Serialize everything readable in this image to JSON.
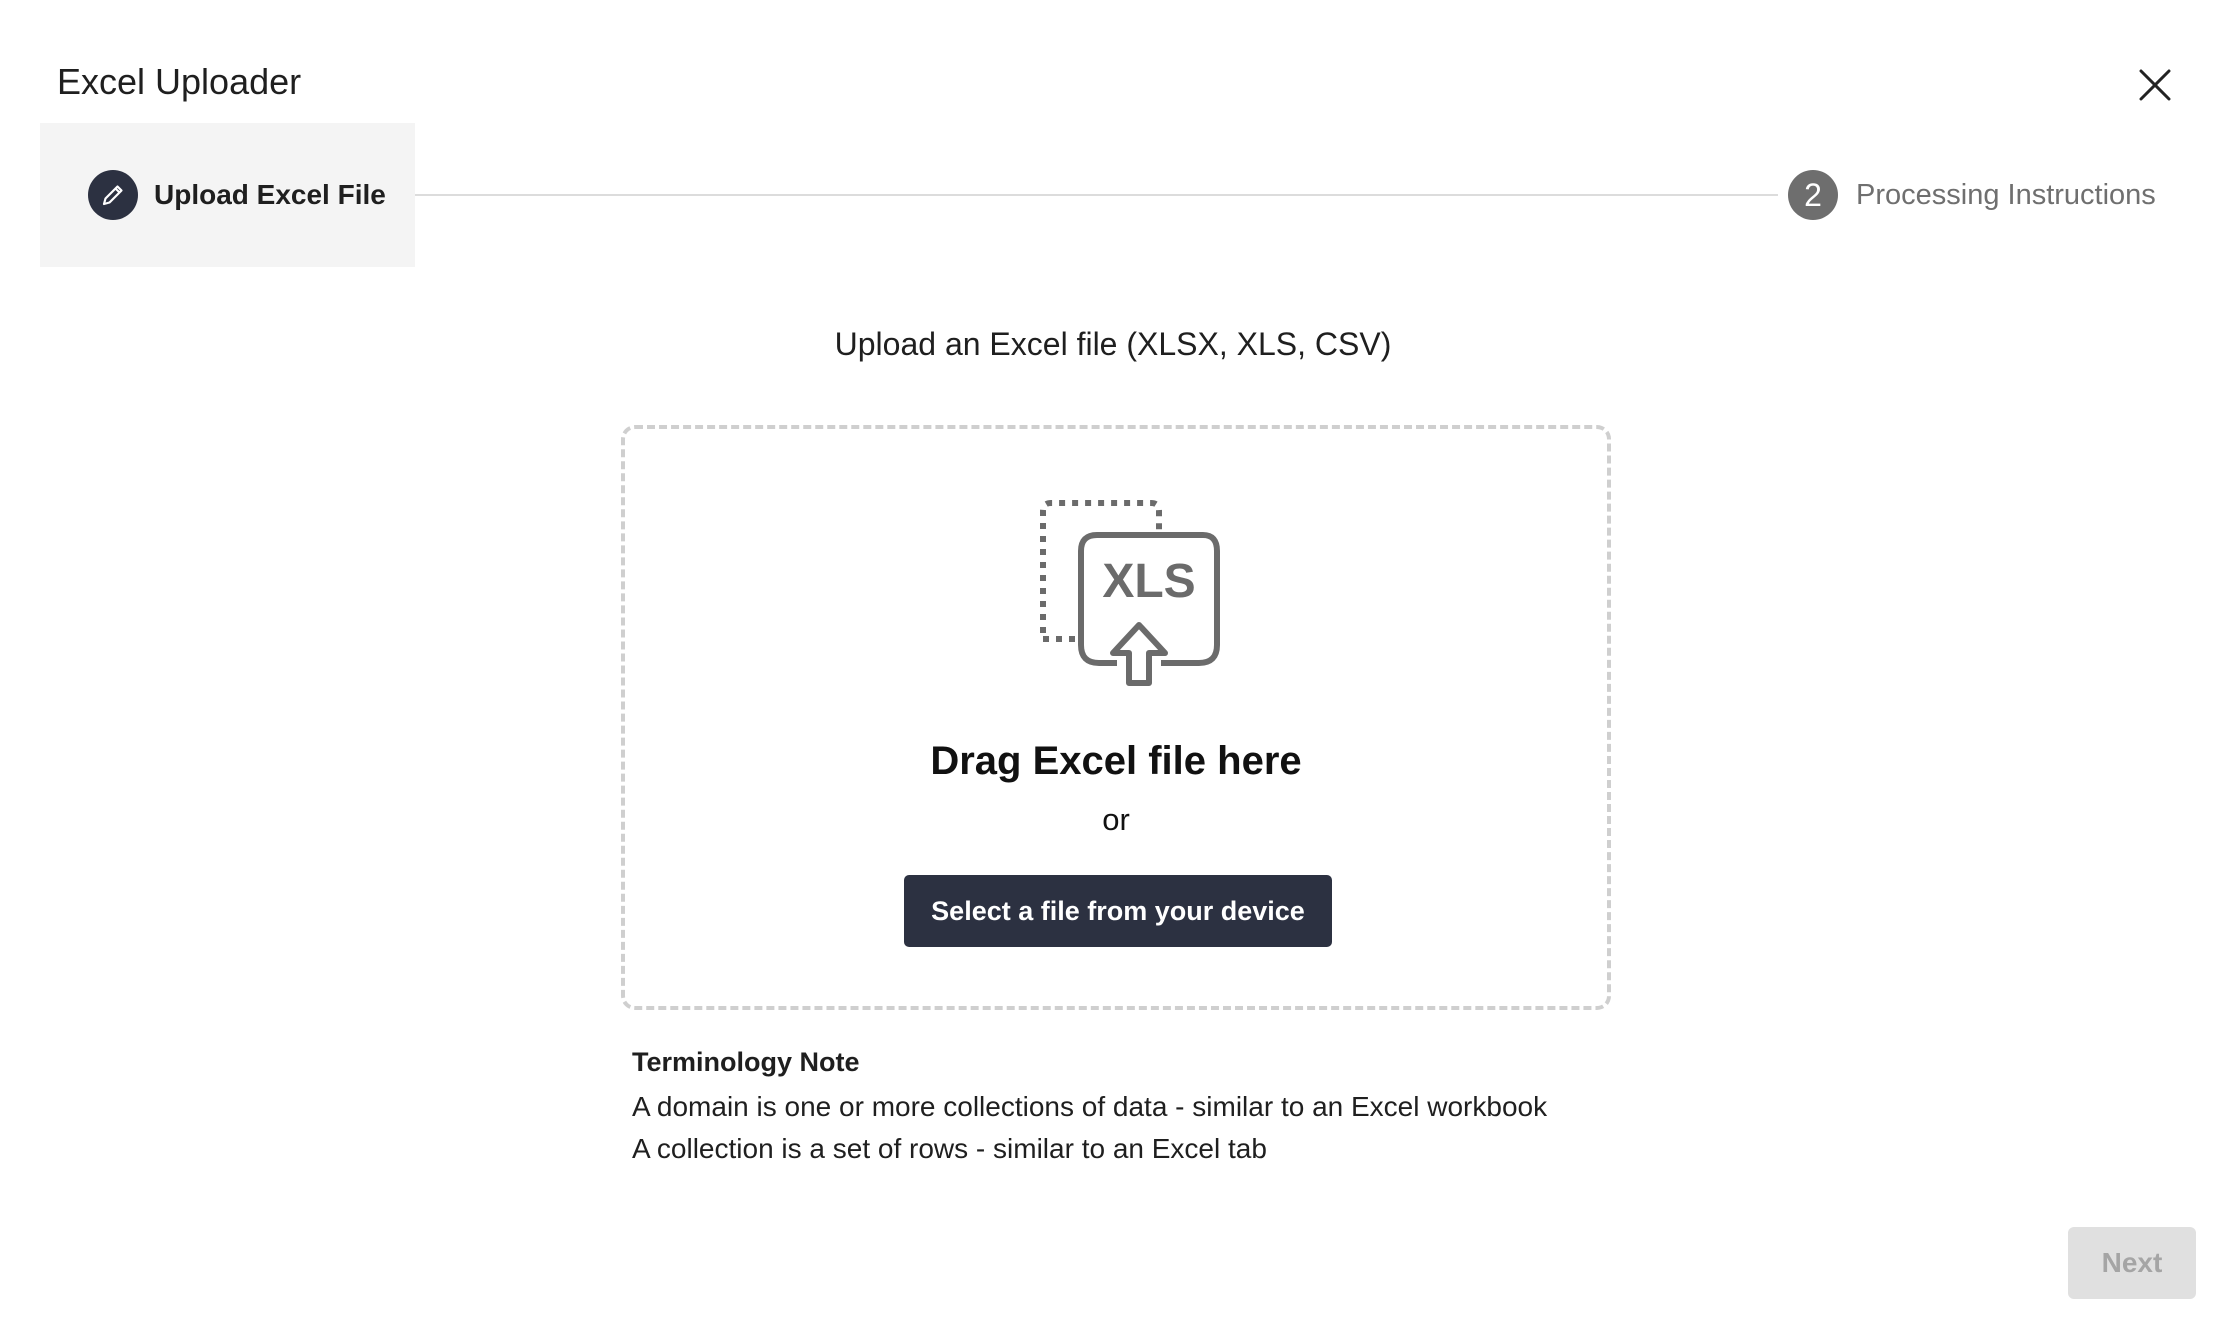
{
  "dialog": {
    "title": "Excel Uploader",
    "close_icon": "close-icon"
  },
  "stepper": {
    "steps": [
      {
        "label": "Upload Excel File",
        "icon": "pencil-icon",
        "state": "active"
      },
      {
        "label": "Processing Instructions",
        "number": "2",
        "state": "inactive"
      }
    ]
  },
  "upload": {
    "heading": "Upload an Excel file (XLSX, XLS, CSV)",
    "icon_text": "XLS",
    "icon": "xls-upload-icon",
    "drag_text": "Drag Excel file here",
    "or_text": "or",
    "select_button": "Select a file from your device"
  },
  "note": {
    "title": "Terminology Note",
    "lines": [
      "A domain is one or more collections of data - similar to an Excel workbook",
      "A collection is a set of rows - similar to an Excel tab"
    ]
  },
  "footer": {
    "next_label": "Next",
    "next_enabled": false
  },
  "colors": {
    "primary": "#2c3141",
    "step_inactive": "#6e6e6e",
    "disabled_bg": "#e0e0e0",
    "disabled_text": "#a5a5a5",
    "dropzone_border": "#cfcfcf"
  }
}
